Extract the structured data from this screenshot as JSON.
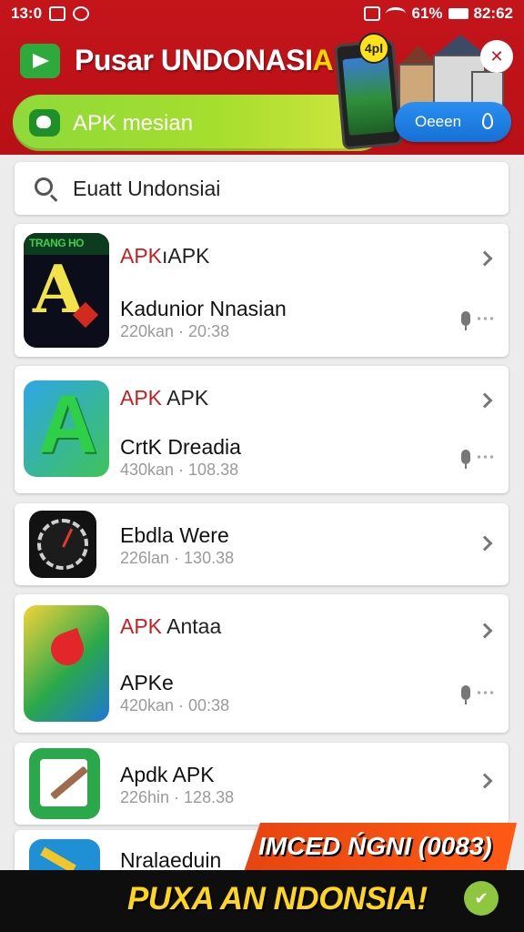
{
  "status_bar": {
    "time": "13:0",
    "battery": "61%",
    "clock": "82:62"
  },
  "header": {
    "title_main": "Pusar UNDONASI",
    "title_accent": "A",
    "banner_text": "APK mesian",
    "phone_badge": "4pl",
    "open_button": "Oeeen",
    "close_icon_text": "✕"
  },
  "search": {
    "text": "Euatt Undonsiai"
  },
  "apps": [
    {
      "icon_label": "TRANG HO",
      "title_red": "APK",
      "title_rest": "ıAPK",
      "name": "Kadunior Nnasian",
      "meta": "220kan · 20:38"
    },
    {
      "title_red": "APK",
      "title_rest": " APK",
      "name": "CrtK Dreadia",
      "meta": "430kan · 108.38"
    },
    {
      "name": "Ebdla Were",
      "meta": "226lan · 130.38"
    },
    {
      "title_red": "APK",
      "title_rest": " Antaa",
      "name": "APKe",
      "meta": "420kan · 00:38"
    },
    {
      "name": "Apdk APK",
      "meta": "226hin · 128.38"
    },
    {
      "name": "Nralaeduin"
    }
  ],
  "promo": {
    "ribbon_text": "IMCED ŃGNI (0083)",
    "main_text": "PUXA AN NDONSIA!",
    "check_icon": "✔"
  },
  "colors": {
    "header_red": "#c4151b",
    "banner_green": "#8fd93a",
    "open_blue": "#1670d6",
    "promo_yellow": "#ffd61a",
    "ribbon_orange": "#ff5a14"
  }
}
